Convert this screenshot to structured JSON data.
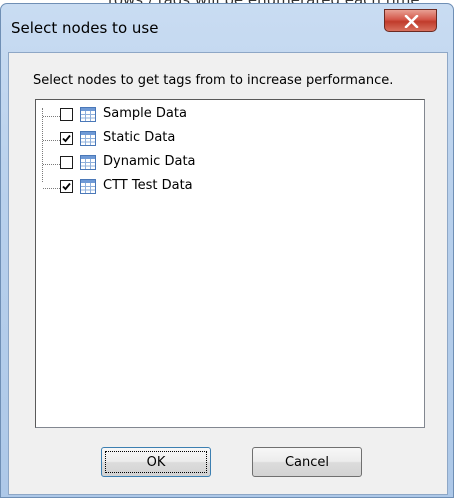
{
  "background_text": "rows / tags will be enumerated each time",
  "window": {
    "title": "Select nodes to use",
    "close_glyph": "X"
  },
  "instruction": "Select nodes to get tags from to increase performance.",
  "nodes": [
    {
      "label": "Sample Data",
      "checked": false,
      "icon": "table-icon"
    },
    {
      "label": "Static Data",
      "checked": true,
      "icon": "table-icon"
    },
    {
      "label": "Dynamic Data",
      "checked": false,
      "icon": "table-icon"
    },
    {
      "label": "CTT Test Data",
      "checked": true,
      "icon": "table-icon"
    }
  ],
  "buttons": {
    "ok_label": "OK",
    "cancel_label": "Cancel"
  },
  "colors": {
    "frame": "#b8d0ec",
    "close_button": "#c03b2b",
    "client_bg": "#f0f0f0"
  }
}
